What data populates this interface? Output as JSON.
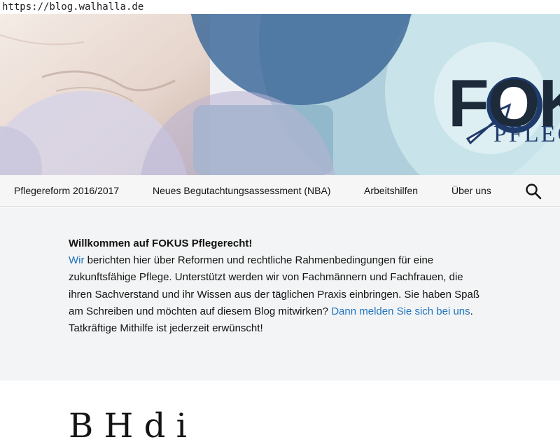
{
  "browser": {
    "url": "https://blog.walhalla.de"
  },
  "header": {
    "logo_main": "FOK",
    "logo_sub": "PFLEG"
  },
  "nav": {
    "items": [
      {
        "label": "Pflegereform 2016/2017"
      },
      {
        "label": "Neues Begutachtungsassessment (NBA)"
      },
      {
        "label": "Arbeitshilfen"
      },
      {
        "label": "Über uns"
      }
    ],
    "search_icon": "search-icon"
  },
  "intro": {
    "heading": "Willkommen auf FOKUS Pflegerecht!",
    "link_wir": "Wir",
    "text_1": " berichten hier über Reformen und rechtliche Rahmenbedingungen für eine zukunftsfähige Pflege. Unterstützt werden wir von Fachmännern und Fachfrauen, die ihren Sachverstand und ihr Wissen aus der täglichen Praxis einbringen. Sie haben Spaß am Schreiben und möchten auf diesem Blog mitwirken? ",
    "link_contact": "Dann melden Sie sich bei uns",
    "text_2": ". Tatkräftige Mithilfe ist jederzeit erwünscht!"
  },
  "post": {
    "title_partial": "B       H  d                     i"
  },
  "colors": {
    "link": "#1e73be",
    "nav_bg": "#f6f6f6",
    "intro_bg": "#f3f4f6",
    "logo_dark": "#1c2a3a",
    "logo_blue": "#1f3b6b"
  }
}
